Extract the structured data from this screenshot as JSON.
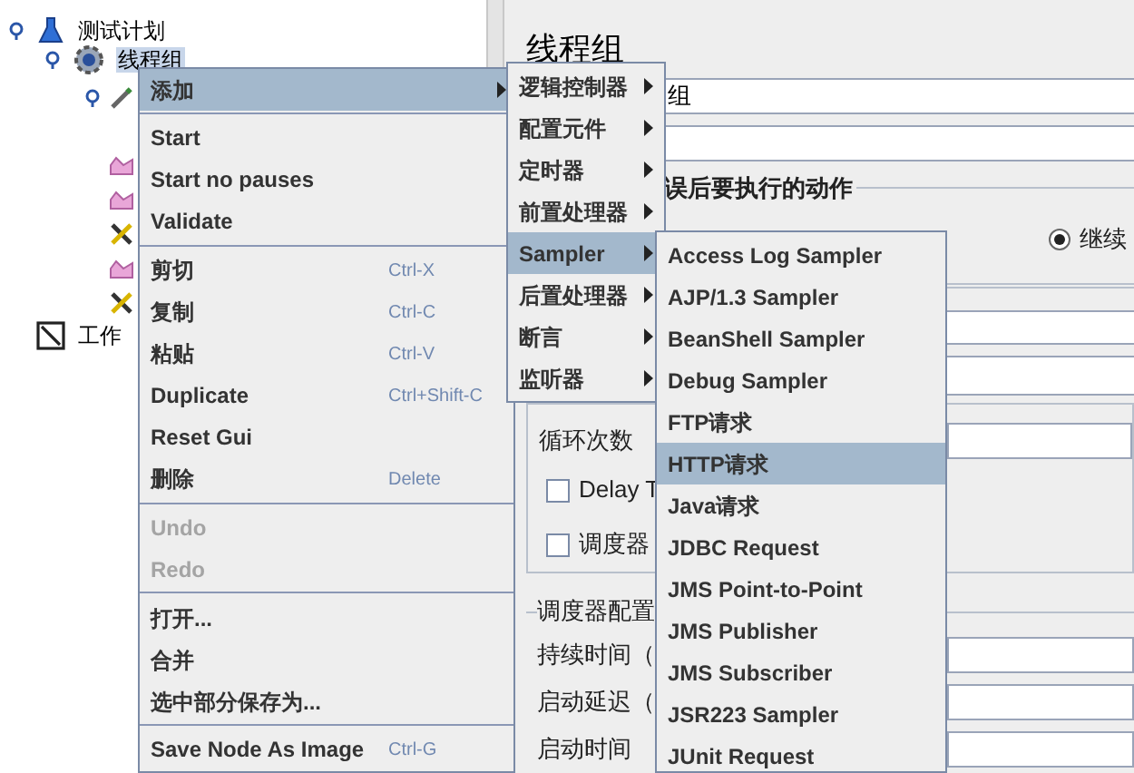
{
  "tree": {
    "items": [
      {
        "label": "测试计划",
        "selected": false,
        "children": [
          {
            "label": "线程组",
            "selected": true
          }
        ]
      },
      {
        "label": "工作",
        "selected": false
      }
    ]
  },
  "editor": {
    "title": "线程组",
    "name_field": {
      "value": "组"
    },
    "error_action": {
      "legend": "误后要执行的动作",
      "options": [
        {
          "label": "继续",
          "selected": true
        }
      ]
    },
    "loop_count": {
      "label": "循环次数"
    },
    "checkboxes": [
      {
        "label": "Delay T",
        "checked": false
      },
      {
        "label": "调度器",
        "checked": false
      }
    ],
    "scheduler": {
      "legend": "调度器配置",
      "rows": [
        {
          "label": "持续时间（"
        },
        {
          "label": "启动延迟（"
        },
        {
          "label": "启动时间"
        }
      ]
    }
  },
  "context_menu": {
    "items": [
      {
        "kind": "submenu",
        "label": "添加",
        "selected": true,
        "disabled": false
      },
      {
        "kind": "separator"
      },
      {
        "kind": "item",
        "label": "Start",
        "selected": false,
        "disabled": false
      },
      {
        "kind": "item",
        "label": "Start no pauses",
        "selected": false,
        "disabled": false
      },
      {
        "kind": "item",
        "label": "Validate",
        "selected": false,
        "disabled": false
      },
      {
        "kind": "separator"
      },
      {
        "kind": "item",
        "label": "剪切",
        "shortcut": "Ctrl-X",
        "selected": false,
        "disabled": false
      },
      {
        "kind": "item",
        "label": "复制",
        "shortcut": "Ctrl-C",
        "selected": false,
        "disabled": false
      },
      {
        "kind": "item",
        "label": "粘贴",
        "shortcut": "Ctrl-V",
        "selected": false,
        "disabled": false
      },
      {
        "kind": "item",
        "label": "Duplicate",
        "shortcut": "Ctrl+Shift-C",
        "selected": false,
        "disabled": false
      },
      {
        "kind": "item",
        "label": "Reset Gui",
        "selected": false,
        "disabled": false
      },
      {
        "kind": "item",
        "label": "删除",
        "shortcut": "Delete",
        "selected": false,
        "disabled": false
      },
      {
        "kind": "separator"
      },
      {
        "kind": "item",
        "label": "Undo",
        "selected": false,
        "disabled": true
      },
      {
        "kind": "item",
        "label": "Redo",
        "selected": false,
        "disabled": true
      },
      {
        "kind": "separator"
      },
      {
        "kind": "item",
        "label": "打开...",
        "selected": false,
        "disabled": false
      },
      {
        "kind": "item",
        "label": "合并",
        "selected": false,
        "disabled": false
      },
      {
        "kind": "item",
        "label": "选中部分保存为...",
        "selected": false,
        "disabled": false
      },
      {
        "kind": "separator"
      },
      {
        "kind": "item",
        "label": "Save Node As Image",
        "shortcut": "Ctrl-G",
        "selected": false,
        "disabled": false
      }
    ]
  },
  "add_submenu": {
    "items": [
      {
        "label": "逻辑控制器",
        "selected": false
      },
      {
        "label": "配置元件",
        "selected": false
      },
      {
        "label": "定时器",
        "selected": false
      },
      {
        "label": "前置处理器",
        "selected": false
      },
      {
        "label": "Sampler",
        "selected": true
      },
      {
        "label": "后置处理器",
        "selected": false
      },
      {
        "label": "断言",
        "selected": false
      },
      {
        "label": "监听器",
        "selected": false
      }
    ]
  },
  "sampler_submenu": {
    "items": [
      {
        "label": "Access Log Sampler",
        "selected": false
      },
      {
        "label": "AJP/1.3 Sampler",
        "selected": false
      },
      {
        "label": "BeanShell Sampler",
        "selected": false
      },
      {
        "label": "Debug Sampler",
        "selected": false
      },
      {
        "label": "FTP请求",
        "selected": false
      },
      {
        "label": "HTTP请求",
        "selected": true
      },
      {
        "label": "Java请求",
        "selected": false
      },
      {
        "label": "JDBC Request",
        "selected": false
      },
      {
        "label": "JMS Point-to-Point",
        "selected": false
      },
      {
        "label": "JMS Publisher",
        "selected": false
      },
      {
        "label": "JMS Subscriber",
        "selected": false
      },
      {
        "label": "JSR223 Sampler",
        "selected": false
      },
      {
        "label": "JUnit Request",
        "selected": false
      }
    ]
  }
}
